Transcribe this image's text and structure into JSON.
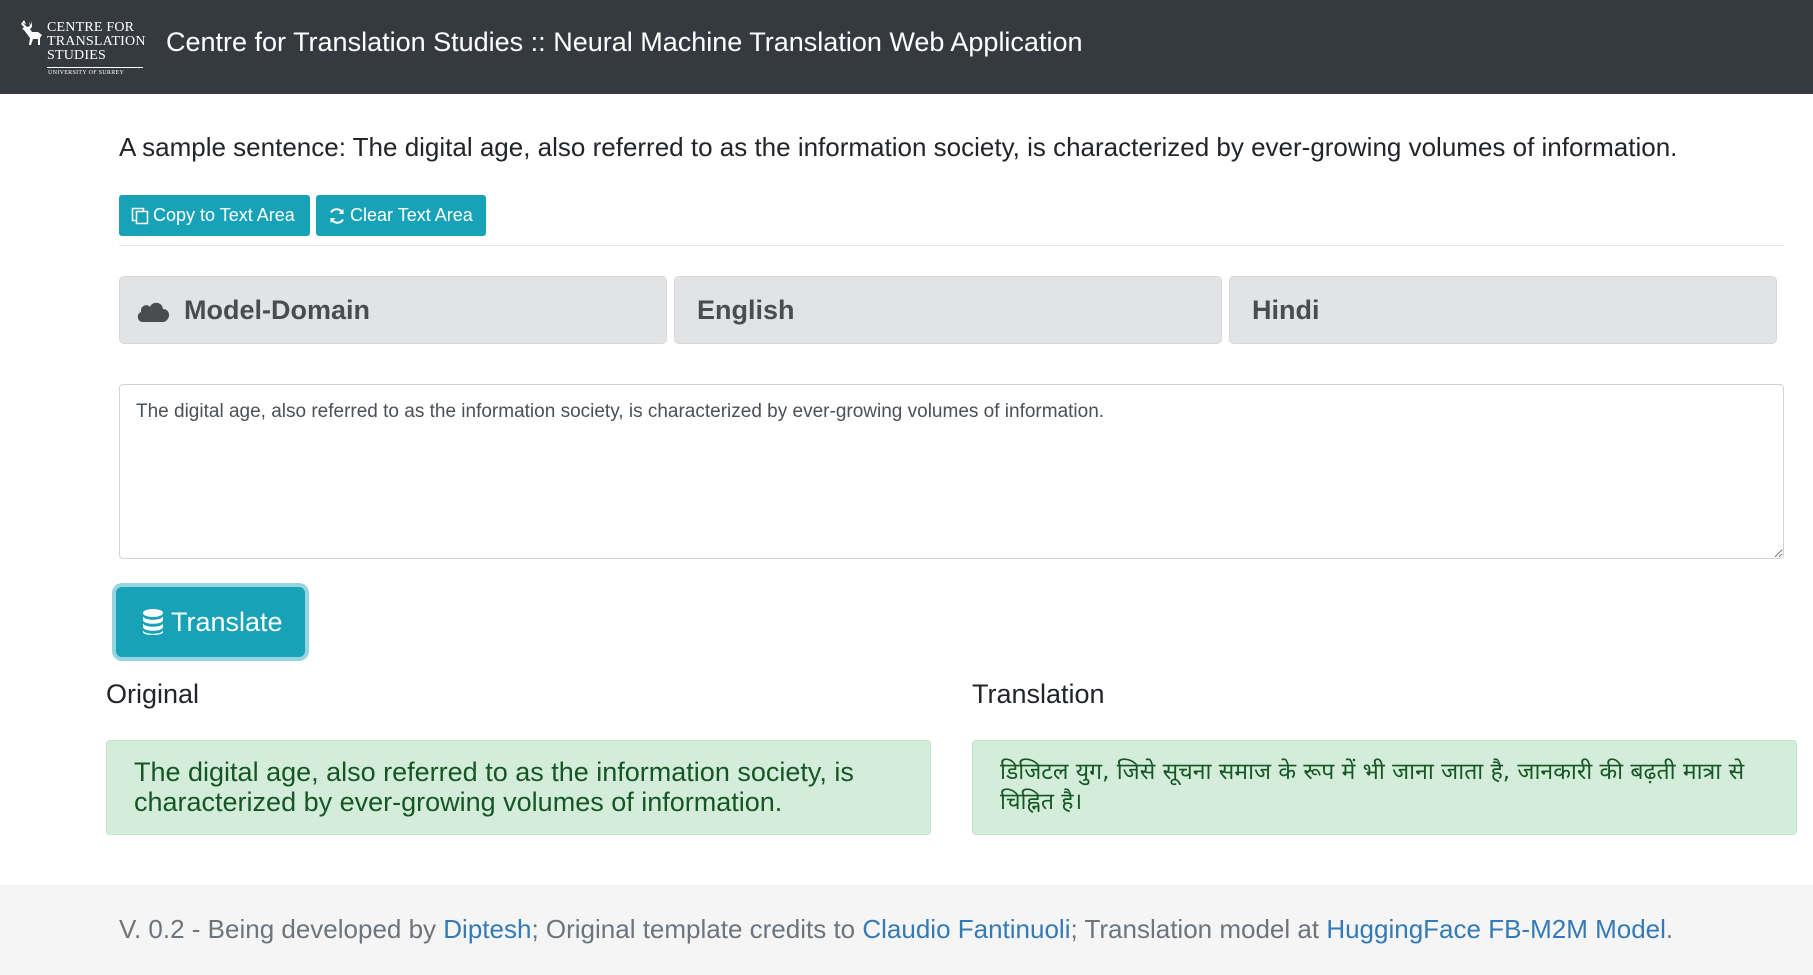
{
  "navbar": {
    "logo": {
      "line1": "CENTRE FOR",
      "line2": "TRANSLATION",
      "line3": "STUDIES",
      "line4": "UNIVERSITY OF SURREY"
    },
    "title": "Centre for Translation Studies :: Neural Machine Translation Web Application"
  },
  "sample": {
    "text": "A sample sentence: The digital age, also referred to as the information society, is characterized by ever-growing volumes of information.",
    "copy_button": "Copy to Text Area",
    "clear_button": "Clear Text Area"
  },
  "selectors": {
    "model": "Model-Domain",
    "source_language": "English",
    "target_language": "Hindi"
  },
  "input": {
    "value": "The digital age, also referred to as the information society, is characterized by ever-growing volumes of information."
  },
  "translate_button": "Translate",
  "results": {
    "original_heading": "Original",
    "translation_heading": "Translation",
    "original_text": "The digital age, also referred to as the information society, is characterized by ever-growing volumes of information.",
    "translation_text": "डिजिटल युग, जिसे सूचना समाज के रूप में भी जाना जाता है, जानकारी की बढ़ती मात्रा से चिह्नित है।"
  },
  "footer": {
    "prefix": "V. 0.2 - Being developed by ",
    "developer_link": "Diptesh",
    "middle1": "; Original template credits to ",
    "template_link": "Claudio Fantinuoli",
    "middle2": "; Translation model at ",
    "model_link": "HuggingFace FB-M2M Model",
    "suffix": "."
  },
  "colors": {
    "navbar_bg": "#343a40",
    "info_button": "#17a2b8",
    "success_bg": "#d4edda",
    "success_text": "#155724",
    "link": "#337ab7"
  }
}
